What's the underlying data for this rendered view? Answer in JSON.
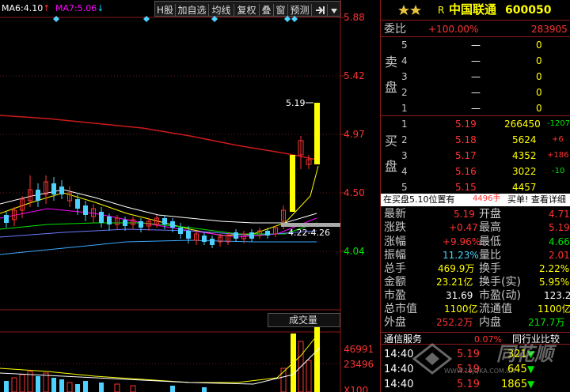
{
  "colors": {
    "up": "#ff3232",
    "down": "#00e600",
    "neutral": "#ffffff",
    "label": "#c8c8c8",
    "blue": "#00d0ff",
    "yellow": "#ffff00",
    "grid": "#8b1a1a",
    "cyan": "#4dd2ff",
    "magenta": "#ff00ff"
  },
  "chart_header": {
    "ma6_label": "MA6:",
    "ma6_value": "4.10",
    "ma6_arrow": "↑",
    "ma7_label": "MA7:",
    "ma7_value": "5.06",
    "ma7_arrow": "↓"
  },
  "toolbar": {
    "buttons": [
      "H股",
      "加自选",
      "均线",
      "复权",
      "叠",
      "窗",
      "预测"
    ],
    "export_icon": "export-icon",
    "dropdown_icon": "chevron-down-icon"
  },
  "price_axis": {
    "labels": [
      "5.88",
      "5.42",
      "4.97",
      "4.50",
      "4.04"
    ]
  },
  "annotations": {
    "high_label": "5.19",
    "range_label": "4.22-4.26"
  },
  "volume": {
    "title": "成交量",
    "axis_labels": [
      "46991",
      "23496",
      "X100"
    ]
  },
  "stock": {
    "market_tag": "R",
    "name": "中国联通",
    "code": "600050",
    "star_icon": "star-icon"
  },
  "order_book": {
    "weibi_label": "委比",
    "weibi_value": "+100.00%",
    "weibi_diff": "283905",
    "sell_group_label": [
      "卖",
      "盘"
    ],
    "sell": [
      {
        "level": "5",
        "price": "—",
        "volume": "0"
      },
      {
        "level": "4",
        "price": "—",
        "volume": "0"
      },
      {
        "level": "3",
        "price": "—",
        "volume": "0"
      },
      {
        "level": "2",
        "price": "—",
        "volume": "0"
      },
      {
        "level": "1",
        "price": "—",
        "volume": "0"
      }
    ],
    "buy_group_label": [
      "买",
      "盘"
    ],
    "buy": [
      {
        "level": "1",
        "price": "5.19",
        "volume": "266450",
        "change": "-1207"
      },
      {
        "level": "2",
        "price": "5.18",
        "volume": "5624",
        "change": "+6"
      },
      {
        "level": "3",
        "price": "5.17",
        "volume": "4352",
        "change": "+186"
      },
      {
        "level": "4",
        "price": "5.16",
        "volume": "3022",
        "change": "-10"
      },
      {
        "level": "5",
        "price": "5.15",
        "volume": "4457",
        "change": ""
      }
    ]
  },
  "buy_hint": {
    "prefix": "在买盘5.10位置有",
    "amount": "4496手",
    "action": "买单! 查看详细"
  },
  "quote": [
    {
      "l1": "最新",
      "v1": "5.19",
      "l2": "开盘",
      "v2": "4.71"
    },
    {
      "l1": "涨跌",
      "v1": "+0.47",
      "l2": "最高",
      "v2": "5.19"
    },
    {
      "l1": "涨幅",
      "v1": "+9.96%",
      "l2": "最低",
      "v2": "4.66"
    },
    {
      "l1": "振幅",
      "v1": "11.23%",
      "l2": "量比",
      "v2": "2.01"
    },
    {
      "l1": "总手",
      "v1": "469.9万",
      "l2": "换手",
      "v2": "2.22%"
    },
    {
      "l1": "金额",
      "v1": "23.21亿",
      "l2": "换手(实)",
      "v2": "5.95%"
    },
    {
      "l1": "市盈",
      "v1": "31.69",
      "l2": "市盈(动)",
      "v2": "123.2"
    },
    {
      "l1": "总市值",
      "v1": "1100亿",
      "l2": "流通值",
      "v2": "1100亿"
    },
    {
      "l1": "外盘",
      "v1": "252.2万",
      "l2": "内盘",
      "v2": "217.7万"
    }
  ],
  "tabs": {
    "left": "通信服务",
    "pct": "0.07%",
    "right": "同行业比较"
  },
  "ticks": [
    {
      "time": "14:40",
      "price": "5.19",
      "vol": "321"
    },
    {
      "time": "14:40",
      "price": "5.19",
      "vol": "645"
    },
    {
      "time": "14:40",
      "price": "5.19",
      "vol": "1865"
    }
  ],
  "watermark": {
    "brand": "同花顺",
    "url": "WWW.10JQKA.COM.CN"
  }
}
